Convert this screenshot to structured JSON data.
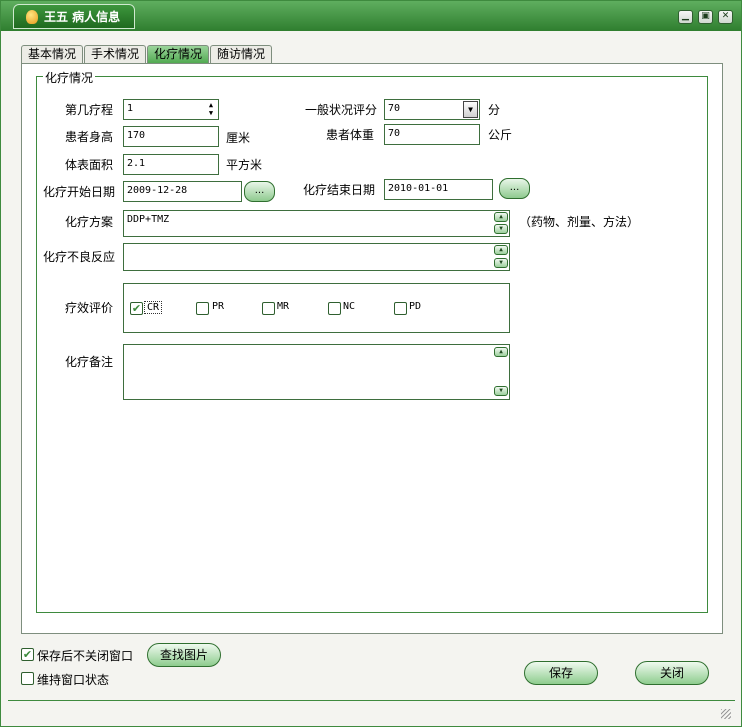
{
  "window": {
    "title": "王五 病人信息",
    "minimize_symbol": "▁",
    "restore_symbol": "▣",
    "close_symbol": "✕"
  },
  "tabs": [
    {
      "label": "基本情况",
      "active": false
    },
    {
      "label": "手术情况",
      "active": false
    },
    {
      "label": "化疗情况",
      "active": true
    },
    {
      "label": "随访情况",
      "active": false
    }
  ],
  "group": {
    "legend": "化疗情况"
  },
  "form": {
    "cycle_label": "第几疗程",
    "cycle_value": "1",
    "performance_label": "一般状况评分",
    "performance_value": "70",
    "performance_unit": "分",
    "height_label": "患者身高",
    "height_value": "170",
    "height_unit": "厘米",
    "weight_label": "患者体重",
    "weight_value": "70",
    "weight_unit": "公斤",
    "bsa_label": "体表面积",
    "bsa_value": "2.1",
    "bsa_unit": "平方米",
    "start_label": "化疗开始日期",
    "start_value": "2009-12-28",
    "end_label": "化疗结束日期",
    "end_value": "2010-01-01",
    "date_button_label": "...",
    "regimen_label": "化疗方案",
    "regimen_value": "DDP+TMZ",
    "regimen_hint": "（药物、剂量、方法）",
    "adverse_label": "化疗不良反应",
    "adverse_value": "",
    "efficacy_label": "疗效评价",
    "efficacy_options": [
      {
        "label": "CR",
        "checked": true
      },
      {
        "label": "PR",
        "checked": false
      },
      {
        "label": "MR",
        "checked": false
      },
      {
        "label": "NC",
        "checked": false
      },
      {
        "label": "PD",
        "checked": false
      }
    ],
    "notes_label": "化疗备注",
    "notes_value": ""
  },
  "footer": {
    "keep_open_label": "保存后不关闭窗口",
    "keep_open_checked": true,
    "keep_state_label": "维持窗口状态",
    "keep_state_checked": false,
    "find_image_label": "查找图片",
    "save_label": "保存",
    "close_label": "关闭"
  },
  "icons": {
    "check": "✔",
    "spin_up": "▲",
    "spin_down": "▼",
    "dropdown": "▼"
  },
  "colors": {
    "accent": "#3e8a3e",
    "titlebar": "#2f7e2f"
  }
}
